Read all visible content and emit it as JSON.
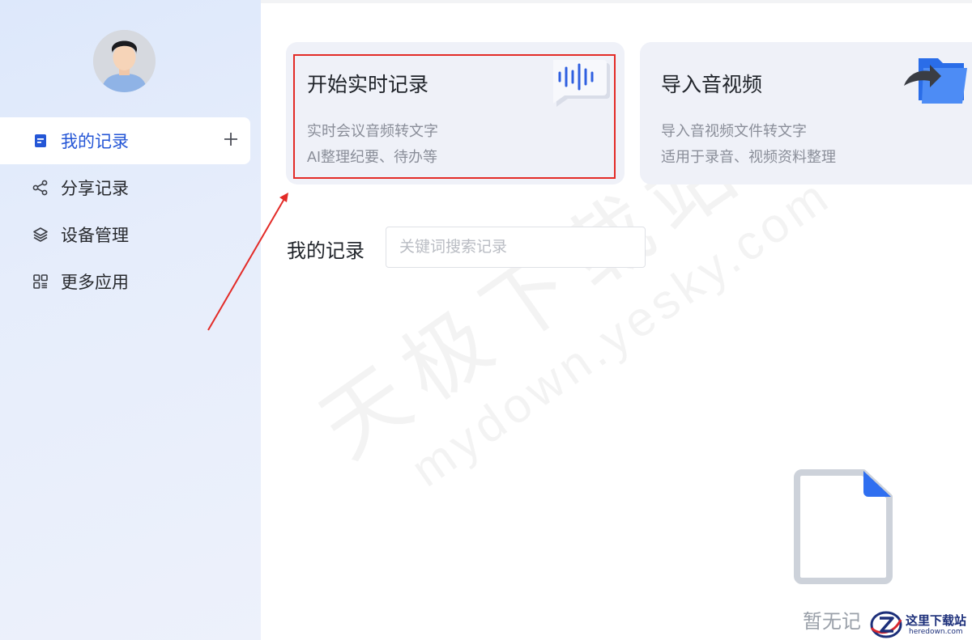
{
  "sidebar": {
    "items": [
      {
        "label": "我的记录",
        "icon": "notes-icon",
        "active": true
      },
      {
        "label": "分享记录",
        "icon": "share-icon"
      },
      {
        "label": "设备管理",
        "icon": "layers-icon"
      },
      {
        "label": "更多应用",
        "icon": "apps-grid-icon"
      }
    ]
  },
  "cards": {
    "live": {
      "title": "开始实时记录",
      "desc1": "实时会议音频转文字",
      "desc2": "AI整理纪要、待办等"
    },
    "import": {
      "title": "导入音视频",
      "desc1": "导入音视频文件转文字",
      "desc2": "适用于录音、视频资料整理"
    }
  },
  "records": {
    "title": "我的记录",
    "search_placeholder": "关键词搜索记录",
    "empty_text": "暂无记"
  },
  "watermark": {
    "cn": "天极下载站",
    "en": "mydown.yesky.com"
  },
  "logo": {
    "cn": "这里下载站",
    "en": "heredown.com"
  },
  "colors": {
    "accent": "#2456d6",
    "highlight": "#e32b27",
    "card_bg": "#eff1f8",
    "sidebar_bg": "#e3ebfb"
  }
}
